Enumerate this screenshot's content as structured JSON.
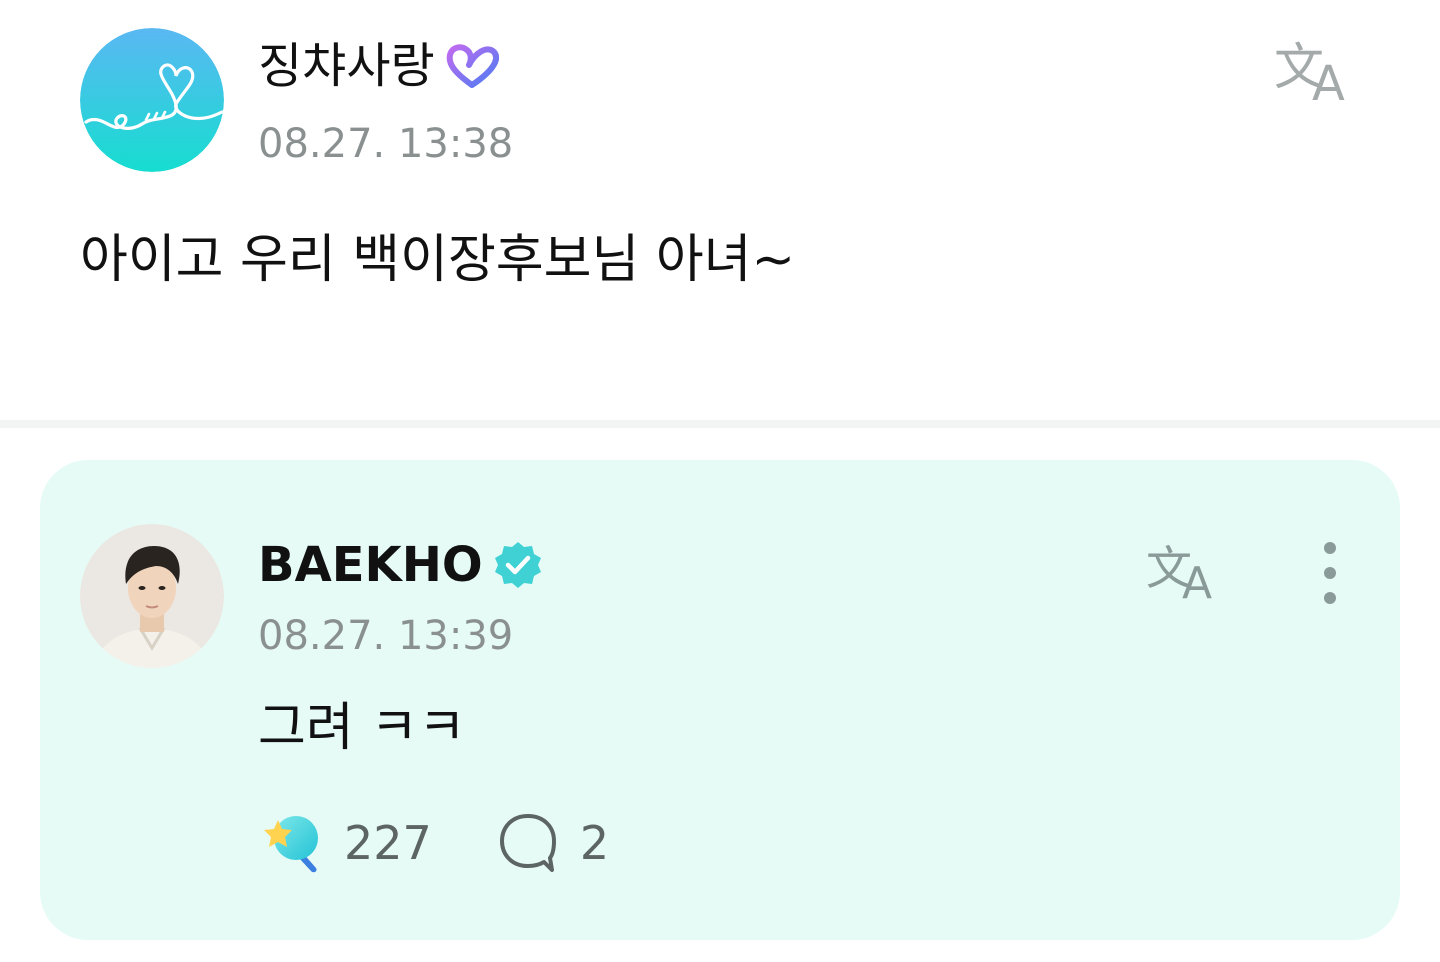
{
  "post": {
    "author": "징챠사랑",
    "timestamp": "08.27. 13:38",
    "content": "아이고 우리 백이장후보님 아녀~",
    "avatar_icon": "heart-string-logo",
    "badge_icon": "purple-heart-badge-icon",
    "translate_icon": "translate-icon"
  },
  "reply": {
    "author": "BAEKHO",
    "timestamp": "08.27. 13:39",
    "content": "그려 ㅋㅋ",
    "avatar_icon": "profile-photo",
    "badge_icon": "verified-badge-icon",
    "translate_icon": "translate-icon",
    "more_icon": "more-vertical-icon",
    "like_count": "227",
    "comment_count": "2"
  },
  "colors": {
    "reply_background": "#e6fbf6",
    "verified_badge": "#3fd1d3",
    "timestamp": "#8a9090",
    "icon_gray": "#8a9a98"
  }
}
